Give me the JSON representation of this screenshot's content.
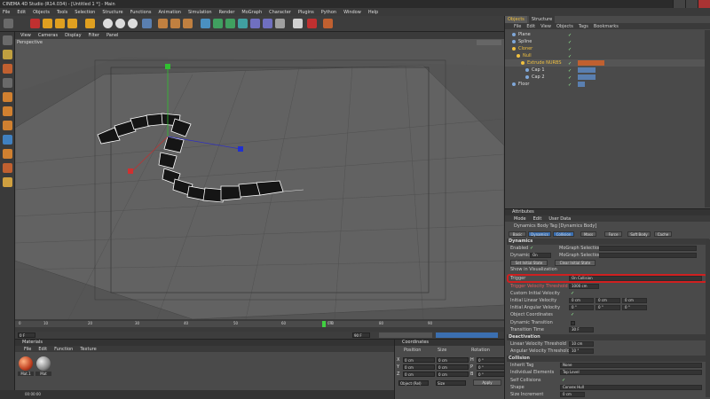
{
  "app": {
    "title": "CINEMA 4D Studio (R14.034) - [Untitled 1 *] - Main"
  },
  "menu": [
    "File",
    "Edit",
    "Objects",
    "Tools",
    "Selection",
    "Structure",
    "Functions",
    "Animation",
    "Simulation",
    "Render",
    "MoGraph",
    "Character",
    "Plugins",
    "Python",
    "Window",
    "Help"
  ],
  "viewport": {
    "menu": [
      "View",
      "Cameras",
      "Display",
      "Filter",
      "Panel"
    ],
    "label": "Perspective"
  },
  "timeline": {
    "ticks": [
      "0",
      "10",
      "20",
      "30",
      "40",
      "50",
      "60",
      "70",
      "80",
      "90"
    ],
    "start": "0 F",
    "end": "90 F",
    "current": "0 F"
  },
  "materials": {
    "title": "Materials",
    "menu": [
      "File",
      "Edit",
      "Function",
      "Texture"
    ],
    "items": [
      {
        "name": "Mat.1"
      },
      {
        "name": "Mat"
      }
    ]
  },
  "coords": {
    "title": "Coordinates",
    "headers": [
      "Position",
      "Size",
      "Rotation"
    ],
    "rows": [
      {
        "axis": "X",
        "pos": "0 cm",
        "size": "0 cm",
        "rlabel": "H",
        "rot": "0 °"
      },
      {
        "axis": "Y",
        "pos": "0 cm",
        "size": "0 cm",
        "rlabel": "P",
        "rot": "0 °"
      },
      {
        "axis": "Z",
        "pos": "0 cm",
        "size": "0 cm",
        "rlabel": "B",
        "rot": "0 °"
      }
    ],
    "mode": "Object (Rel)",
    "size_mode": "Size",
    "apply": "Apply"
  },
  "status": {
    "time": "00:00:00"
  },
  "objects": {
    "tabs": [
      "Objects",
      "Structure"
    ],
    "menu": [
      "File",
      "Edit",
      "View",
      "Objects",
      "Tags",
      "Bookmarks"
    ],
    "items": [
      {
        "name": "Plane",
        "indent": 0,
        "color": "#7fa7d8"
      },
      {
        "name": "Spline",
        "indent": 0,
        "color": "#7fa7d8"
      },
      {
        "name": "Cloner",
        "indent": 0,
        "color": "#f0c040"
      },
      {
        "name": "Null",
        "indent": 1,
        "color": "#f0c040"
      },
      {
        "name": "Extrude NURBS",
        "indent": 2,
        "color": "#f0c040"
      },
      {
        "name": "Cap 1",
        "indent": 3,
        "color": "#7fa7d8"
      },
      {
        "name": "Cap 2",
        "indent": 3,
        "color": "#7fa7d8"
      },
      {
        "name": "Floor",
        "indent": 0,
        "color": "#7fa7d8"
      }
    ]
  },
  "attributes": {
    "title": "Attributes",
    "menu": [
      "Mode",
      "Edit",
      "User Data"
    ],
    "tag": "Dynamics Body Tag [Dynamics Body]",
    "tabs": [
      "Basic",
      "Dynamics",
      "Collision",
      "Mass",
      "Force",
      "Soft Body",
      "Cache"
    ],
    "section_dynamics": "Dynamics",
    "enabled_label": "Enabled",
    "mograph_selection": "MoGraph Selection",
    "dynamic_label": "Dynamic",
    "dynamic_value": "On",
    "set_initial": "Set Initial State",
    "clear_initial": "Clear Initial State",
    "show_vis": "Show in Visualization",
    "trigger_label": "Trigger",
    "trigger_value": "On Collision",
    "trigger_vel_label": "Trigger Velocity Threshold",
    "trigger_vel_value": "1000 cm",
    "custom_vel_label": "Custom Initial Velocity",
    "init_lin_label": "Initial Linear Velocity",
    "init_lin_vals": [
      "0 cm",
      "0 cm",
      "0 cm"
    ],
    "init_ang_label": "Initial Angular Velocity",
    "init_ang_vals": [
      "0 °",
      "0 °",
      "0 °"
    ],
    "obj_coords_label": "Object Coordinates",
    "dyn_trans_label": "Dynamic Transition",
    "trans_time_label": "Transition Time",
    "trans_time_value": "30 F",
    "section_deact": "Deactivation",
    "lin_thresh_label": "Linear Velocity Threshold",
    "lin_thresh_value": "10 cm",
    "ang_thresh_label": "Angular Velocity Threshold",
    "ang_thresh_value": "10 °",
    "section_collision": "Collision",
    "inherit_label": "Inherit Tag",
    "inherit_value": "None",
    "indiv_label": "Individual Elements",
    "indiv_value": "Top Level",
    "self_coll_label": "Self Collisions",
    "shape_label": "Shape",
    "shape_value": "Convex Hull",
    "size_inc_label": "Size Increment",
    "size_inc_value": "0 cm"
  },
  "colors": {
    "accent": "#f0c040",
    "highlight": "#d02020",
    "selection": "#3b6fb0"
  }
}
